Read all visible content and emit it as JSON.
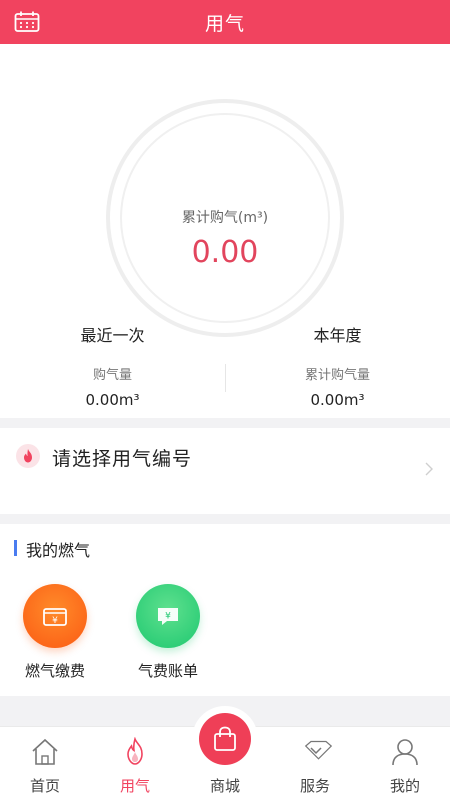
{
  "header": {
    "title": "用气",
    "calendar_icon": "calendar-icon"
  },
  "gauge": {
    "label": "累计购气(m³)",
    "value": "0.00"
  },
  "stats": {
    "recent": {
      "title": "最近一次",
      "sub": "购气量",
      "value": "0.00m³"
    },
    "year": {
      "title": "本年度",
      "sub": "累计购气量",
      "value": "0.00m³"
    }
  },
  "select": {
    "text": "请选择用气编号",
    "icon": "fire-icon"
  },
  "my_gas": {
    "title": "我的燃气",
    "items": [
      {
        "label": "燃气缴费",
        "icon": "payment-icon",
        "glyph": "¥"
      },
      {
        "label": "气费账单",
        "icon": "bill-icon",
        "glyph": "¥"
      }
    ]
  },
  "nav": [
    {
      "label": "首页",
      "icon": "home-icon"
    },
    {
      "label": "用气",
      "icon": "flame-icon"
    },
    {
      "label": "商城",
      "icon": "shopping-bag-icon"
    },
    {
      "label": "服务",
      "icon": "service-icon"
    },
    {
      "label": "我的",
      "icon": "profile-icon"
    }
  ],
  "colors": {
    "brand": "#f1435f",
    "pay_orange": "#fb5a13",
    "bill_green": "#1ec870",
    "accent_blue": "#4a7cf0"
  }
}
